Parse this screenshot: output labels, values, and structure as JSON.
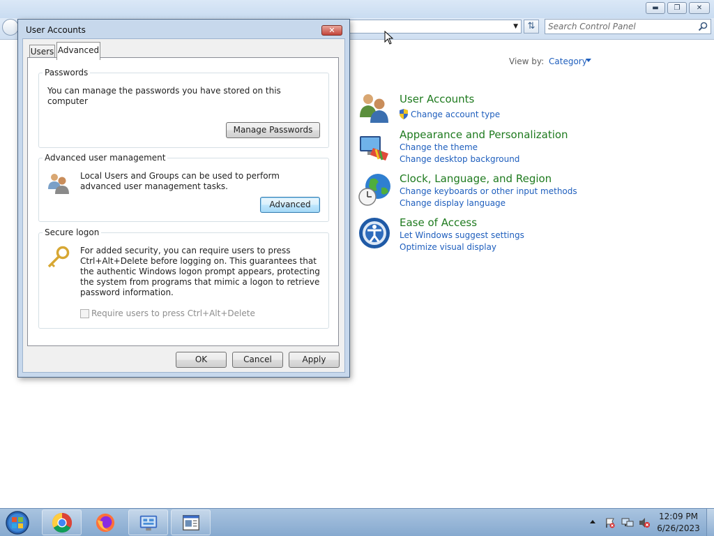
{
  "control_panel": {
    "search": {
      "placeholder": "Search Control Panel"
    },
    "view_by": {
      "label": "View by:",
      "value": "Category"
    },
    "categories": [
      {
        "title": "User Accounts",
        "icon": "users-icon",
        "links": [
          "Change account type"
        ]
      },
      {
        "title": "Appearance and Personalization",
        "icon": "appearance-icon",
        "links": [
          "Change the theme",
          "Change desktop background"
        ]
      },
      {
        "title": "Clock, Language, and Region",
        "icon": "globe-clock-icon",
        "links": [
          "Change keyboards or other input methods",
          "Change display language"
        ]
      },
      {
        "title": "Ease of Access",
        "icon": "ease-of-access-icon",
        "links": [
          "Let Windows suggest settings",
          "Optimize visual display"
        ]
      }
    ]
  },
  "dialog": {
    "title": "User Accounts",
    "tabs": [
      "Users",
      "Advanced"
    ],
    "active_tab": "Advanced",
    "passwords": {
      "label": "Passwords",
      "text": "You can manage the passwords you have stored on this computer",
      "button": "Manage Passwords"
    },
    "advanced_management": {
      "label": "Advanced user management",
      "text": "Local Users and Groups can be used to perform advanced user management tasks.",
      "button": "Advanced"
    },
    "secure_logon": {
      "label": "Secure logon",
      "text": "For added security, you can require users to press Ctrl+Alt+Delete before logging on. This guarantees that the authentic Windows logon prompt appears, protecting the system from programs that mimic a logon to retrieve password information.",
      "checkbox_label": "Require users to press Ctrl+Alt+Delete",
      "checkbox_checked": false
    },
    "buttons": {
      "ok": "OK",
      "cancel": "Cancel",
      "apply": "Apply"
    }
  },
  "taskbar": {
    "items": [
      "chrome-icon",
      "firefox-icon",
      "control-panel-icon",
      "user-accounts-window-icon"
    ],
    "clock": {
      "time": "12:09 PM",
      "date": "6/26/2023"
    }
  }
}
